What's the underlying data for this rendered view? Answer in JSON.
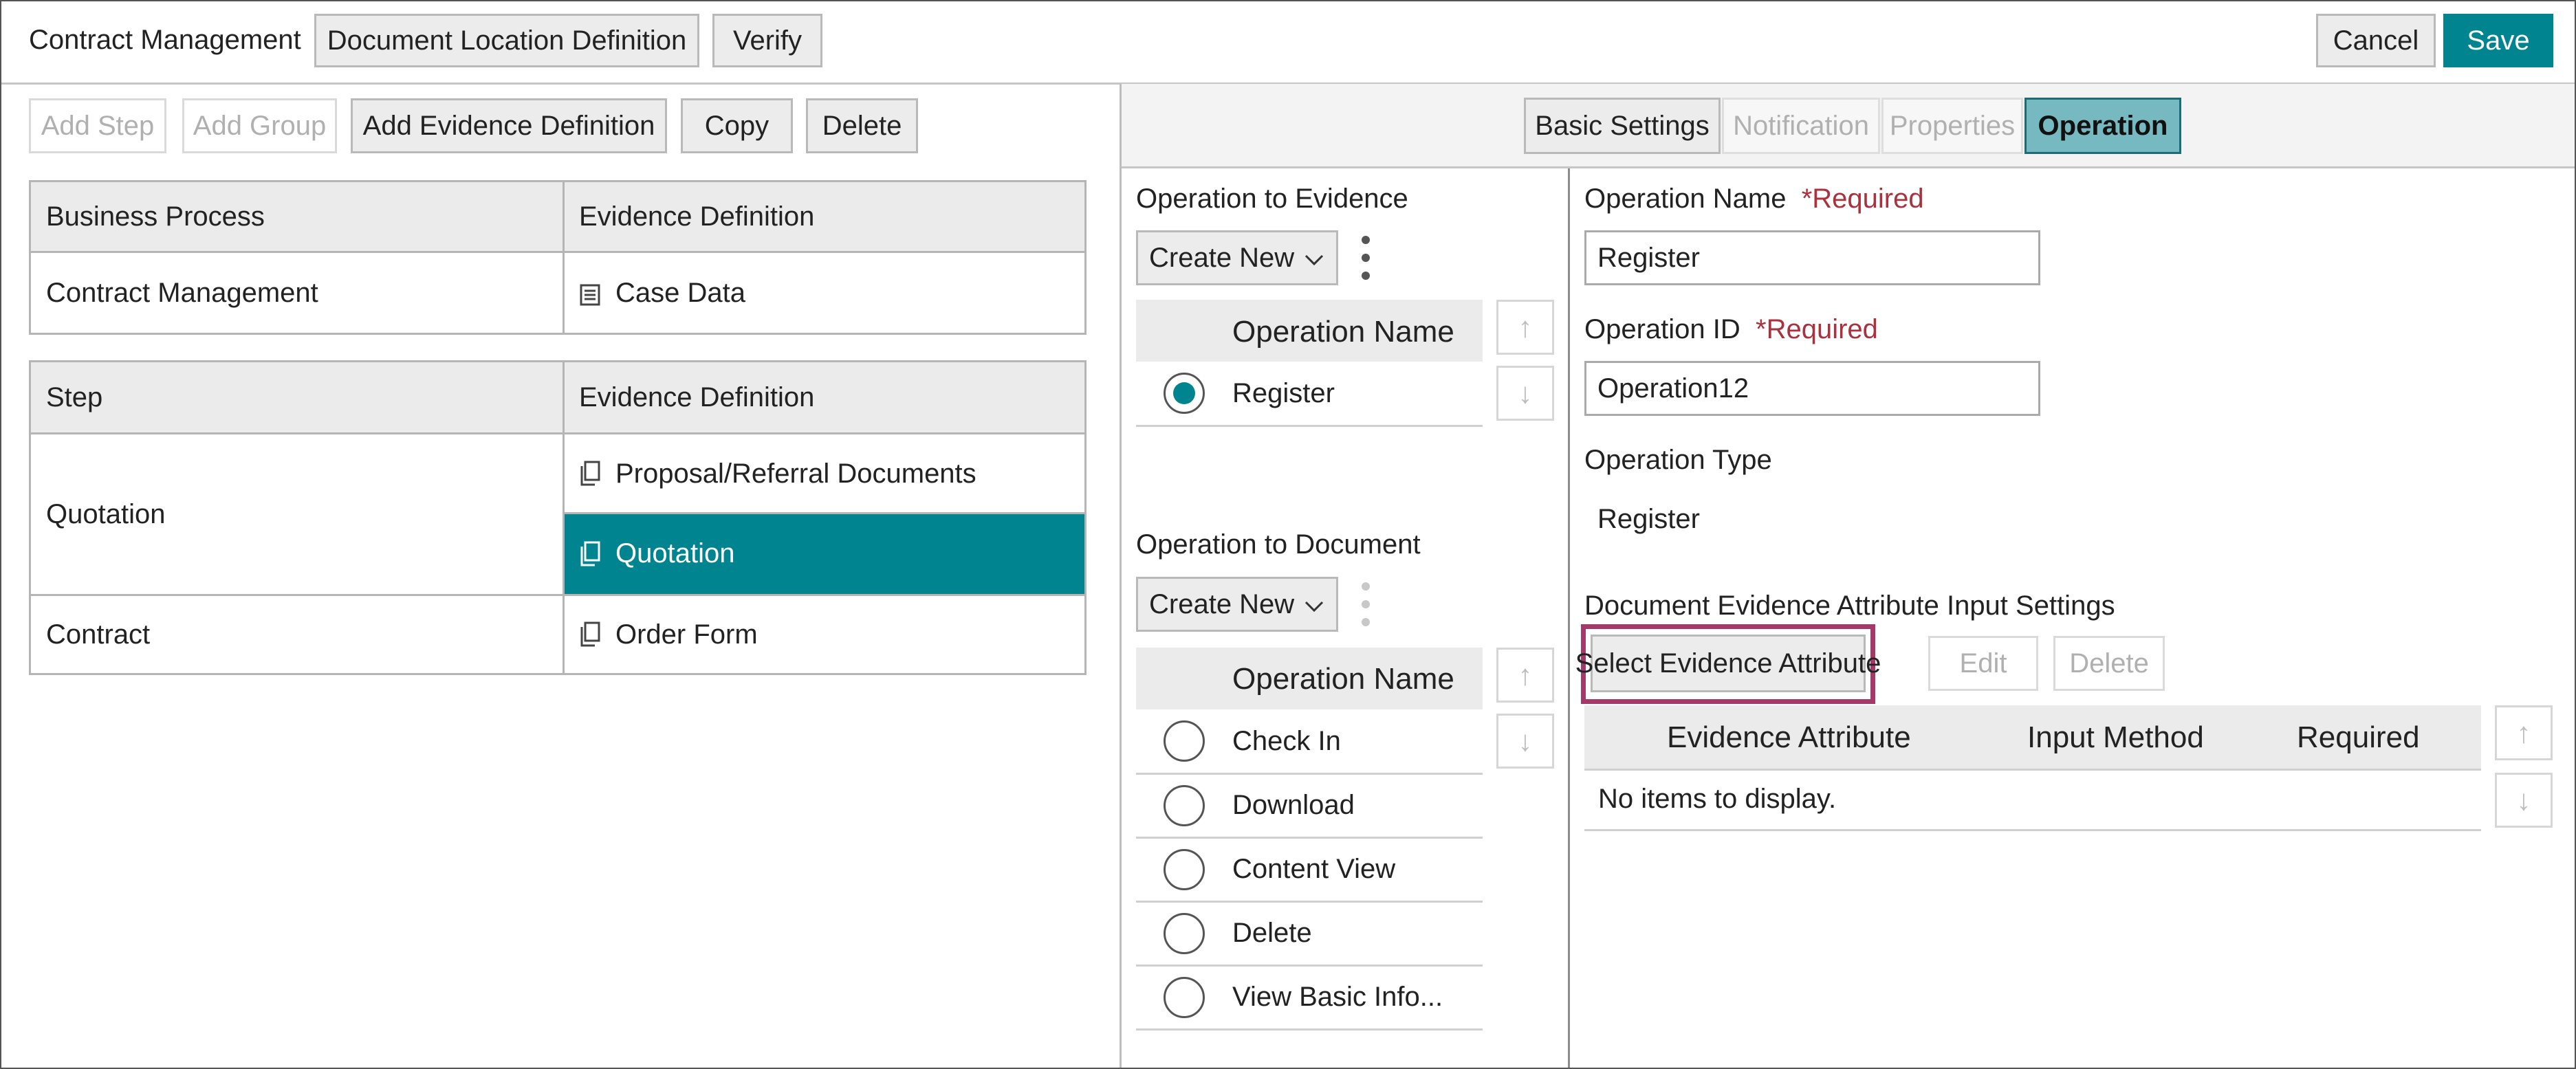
{
  "header": {
    "title": "Contract Management",
    "doc_location_label": "Document Location Definition",
    "verify_label": "Verify",
    "cancel_label": "Cancel",
    "save_label": "Save"
  },
  "toolbar": {
    "add_step": "Add Step",
    "add_group": "Add Group",
    "add_evidence": "Add Evidence Definition",
    "copy": "Copy",
    "delete": "Delete"
  },
  "process_table": {
    "col1": "Business Process",
    "col2": "Evidence Definition",
    "row_process": "Contract Management",
    "row_evidence": "Case Data"
  },
  "step_table": {
    "col1": "Step",
    "col2": "Evidence Definition",
    "rows": [
      {
        "step": "Quotation",
        "evidence": [
          "Proposal/Referral Documents",
          "Quotation"
        ]
      },
      {
        "step": "Contract",
        "evidence": [
          "Order Form"
        ]
      }
    ],
    "selected": "Quotation"
  },
  "tabs": [
    "Basic Settings",
    "Notification",
    "Properties",
    "Operation"
  ],
  "active_tab": "Operation",
  "op_evidence": {
    "title": "Operation to Evidence",
    "create_new": "Create New",
    "col": "Operation Name",
    "items": [
      "Register"
    ],
    "selected": "Register"
  },
  "op_document": {
    "title": "Operation to Document",
    "create_new": "Create New",
    "col": "Operation Name",
    "items": [
      "Check In",
      "Download",
      "Content View",
      "Delete",
      "View Basic Info..."
    ]
  },
  "form": {
    "name_label": "Operation Name",
    "required": "*Required",
    "name_value": "Register",
    "id_label": "Operation ID",
    "id_value": "Operation12",
    "type_label": "Operation Type",
    "type_value": "Register",
    "attr_section": "Document Evidence Attribute Input Settings",
    "select_attr": "Select Evidence Attribute",
    "edit": "Edit",
    "delete": "Delete",
    "cols": [
      "Evidence Attribute",
      "Input Method",
      "Required"
    ],
    "empty": "No items to display."
  },
  "colors": {
    "accent": "#008490",
    "highlight": "#a33a6a",
    "required": "#a8323e"
  }
}
